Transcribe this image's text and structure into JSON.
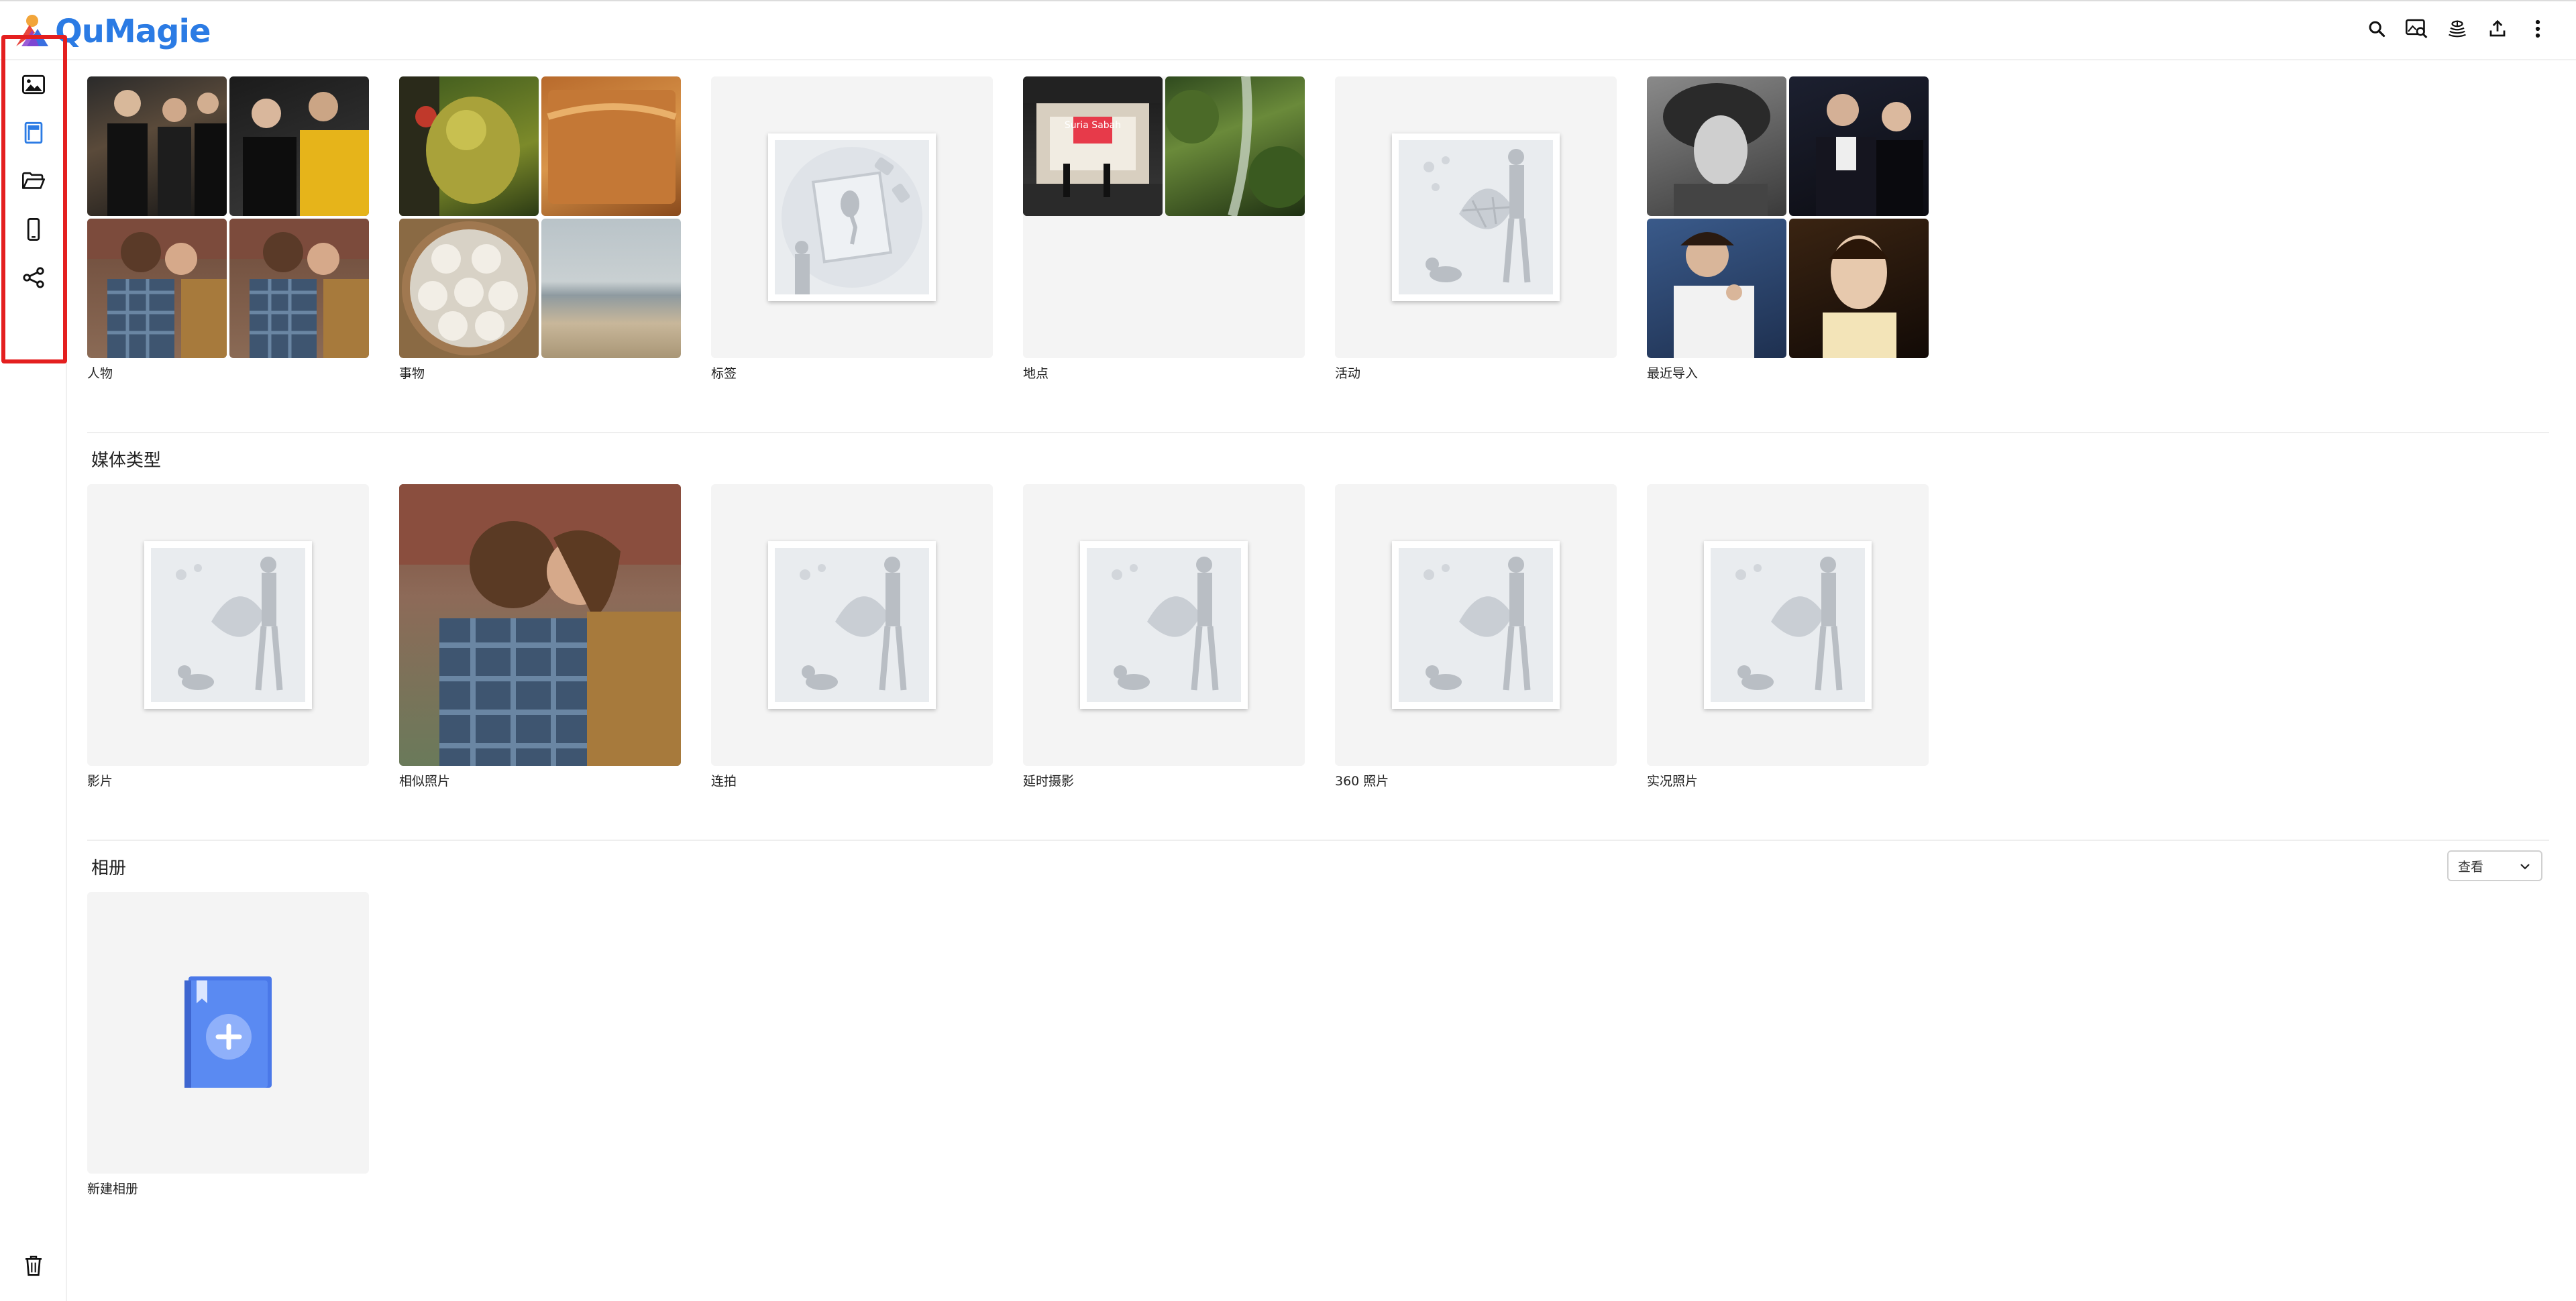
{
  "app": {
    "name": "QuMagie"
  },
  "top_icons": [
    "search-icon",
    "image-search-icon",
    "coin-stack-icon",
    "upload-icon",
    "more-vert-icon"
  ],
  "sidebar": {
    "items": [
      {
        "name": "photos",
        "icon": "image-icon"
      },
      {
        "name": "albums",
        "icon": "album-icon",
        "active": true
      },
      {
        "name": "folders",
        "icon": "folder-open-icon"
      },
      {
        "name": "devices",
        "icon": "phone-icon"
      },
      {
        "name": "shared",
        "icon": "share-icon"
      }
    ],
    "trash_icon": "trash-icon",
    "accent": "#2b7be4"
  },
  "categories": [
    {
      "label": "人物"
    },
    {
      "label": "事物"
    },
    {
      "label": "标签"
    },
    {
      "label": "地点"
    },
    {
      "label": "活动"
    },
    {
      "label": "最近导入"
    }
  ],
  "media_types": {
    "title": "媒体类型",
    "items": [
      {
        "label": "影片"
      },
      {
        "label": "相似照片"
      },
      {
        "label": "连拍"
      },
      {
        "label": "延时摄影"
      },
      {
        "label": "360 照片"
      },
      {
        "label": "实况照片"
      }
    ]
  },
  "albums": {
    "title": "相册",
    "view_select": "查看",
    "new_album_label": "新建相册"
  },
  "place_sign": "Suria Sabah"
}
